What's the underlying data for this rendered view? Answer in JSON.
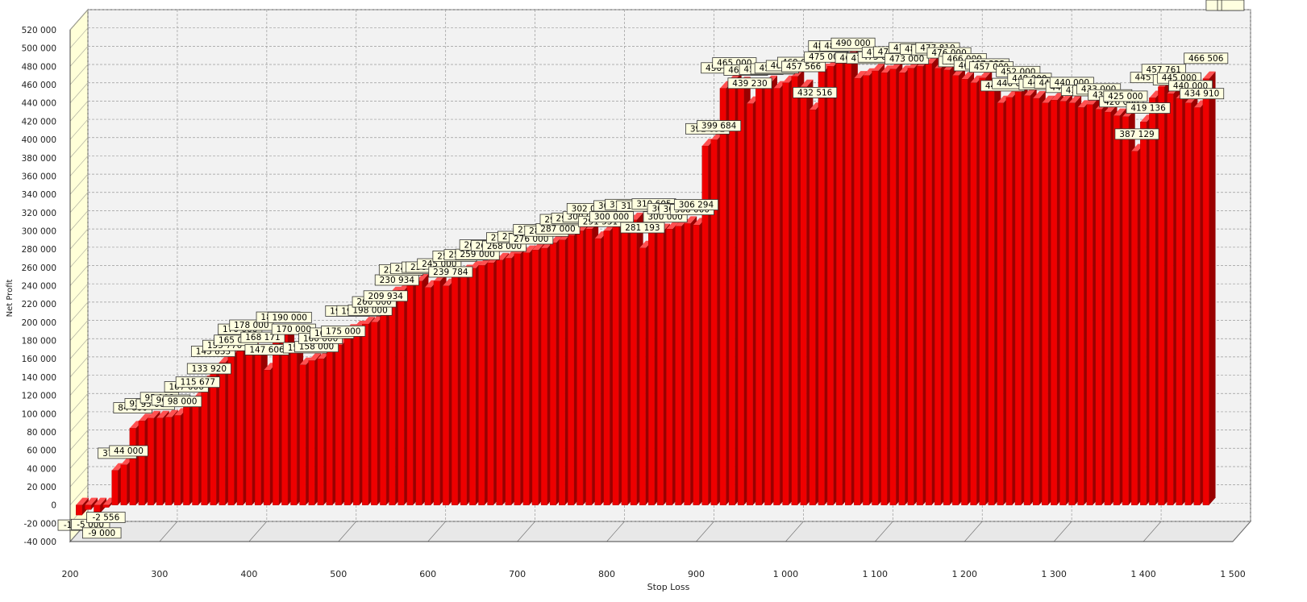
{
  "chart_data": {
    "type": "bar",
    "style": "3d",
    "xlabel": "Stop Loss",
    "ylabel": "Net Profit",
    "x_ticks": [
      200,
      300,
      400,
      500,
      600,
      700,
      800,
      900,
      1000,
      1100,
      1200,
      1300,
      1400,
      1500
    ],
    "x_tick_labels": [
      "200",
      "300",
      "400",
      "500",
      "600",
      "700",
      "800",
      "900",
      "1 000",
      "1 100",
      "1 200",
      "1 300",
      "1 400",
      "1 500"
    ],
    "y_ticks": [
      -40000,
      -20000,
      0,
      20000,
      40000,
      60000,
      80000,
      100000,
      120000,
      140000,
      160000,
      180000,
      200000,
      220000,
      240000,
      260000,
      280000,
      300000,
      320000,
      340000,
      360000,
      380000,
      400000,
      420000,
      440000,
      460000,
      480000,
      500000,
      520000
    ],
    "y_tick_labels": [
      "-40 000",
      "-20 000",
      "0",
      "20 000",
      "40 000",
      "60 000",
      "80 000",
      "100 000",
      "120 000",
      "140 000",
      "160 000",
      "180 000",
      "200 000",
      "220 000",
      "240 000",
      "260 000",
      "280 000",
      "300 000",
      "320 000",
      "340 000",
      "360 000",
      "380 000",
      "400 000",
      "420 000",
      "440 000",
      "460 000",
      "480 000",
      "500 000",
      "520 000"
    ],
    "xlim": [
      200,
      1500
    ],
    "ylim": [
      -40000,
      520000
    ],
    "grid": true,
    "colors": {
      "bar_front": "#ee0000",
      "bar_top": "#ff5050",
      "bar_side": "#990000",
      "label_bg": "#ffffe0",
      "back_wall": "#f2f2f2",
      "side_wall": "#ffffd8"
    },
    "x": [
      210,
      220,
      230,
      240,
      250,
      260,
      270,
      280,
      290,
      300,
      310,
      320,
      330,
      340,
      350,
      360,
      370,
      380,
      390,
      400,
      410,
      420,
      430,
      440,
      450,
      460,
      470,
      480,
      490,
      500,
      510,
      520,
      530,
      540,
      550,
      560,
      570,
      580,
      590,
      600,
      610,
      620,
      630,
      640,
      650,
      660,
      670,
      680,
      690,
      700,
      710,
      720,
      730,
      740,
      750,
      760,
      770,
      780,
      790,
      800,
      810,
      820,
      830,
      840,
      850,
      860,
      870,
      880,
      890,
      900,
      910,
      920,
      930,
      940,
      950,
      960,
      970,
      980,
      990,
      1000,
      1010,
      1020,
      1030,
      1040,
      1050,
      1060,
      1070,
      1080,
      1090,
      1100,
      1110,
      1120,
      1130,
      1140,
      1150,
      1160,
      1170,
      1180,
      1190,
      1200,
      1210,
      1220,
      1230,
      1240,
      1250,
      1260,
      1270,
      1280,
      1290,
      1300,
      1310,
      1320,
      1330,
      1340,
      1350,
      1360,
      1370,
      1380,
      1390,
      1400,
      1410,
      1420,
      1430,
      1440,
      1450,
      1460,
      1470,
      1480,
      1490,
      1500
    ],
    "values": [
      -11000,
      -5000,
      -9000,
      -2556,
      37863,
      44000,
      84000,
      92000,
      95000,
      95193,
      96018,
      98000,
      107000,
      115677,
      133920,
      145833,
      155770,
      165000,
      170000,
      178000,
      168171,
      147606,
      186747,
      190000,
      170000,
      153315,
      158000,
      160000,
      169254,
      175000,
      190000,
      193655,
      198000,
      200000,
      209934,
      230934,
      235000,
      240000,
      245000,
      238000,
      245000,
      239784,
      250000,
      255000,
      259000,
      262155,
      265000,
      268000,
      270000,
      275000,
      276000,
      279000,
      281000,
      287000,
      290000,
      295000,
      300000,
      302000,
      291531,
      300000,
      305000,
      310000,
      312000,
      281193,
      310605,
      300000,
      302000,
      305000,
      308000,
      306294,
      392892,
      399684,
      456000,
      465000,
      460704,
      439230,
      458000,
      462000,
      456000,
      462000,
      469000,
      457566,
      432516,
      475000,
      480000,
      483680,
      490000,
      467000,
      470000,
      475000,
      473000,
      477000,
      473000,
      478000,
      480000,
      483000,
      477810,
      476000,
      470000,
      466000,
      462000,
      467325,
      457000,
      440000,
      446000,
      452000,
      448000,
      445000,
      440000,
      443000,
      441818,
      440000,
      435000,
      438169,
      433000,
      430000,
      426000,
      425000,
      387129,
      419136,
      445515,
      457761,
      450000,
      445000,
      440000,
      434910,
      466506
    ]
  }
}
